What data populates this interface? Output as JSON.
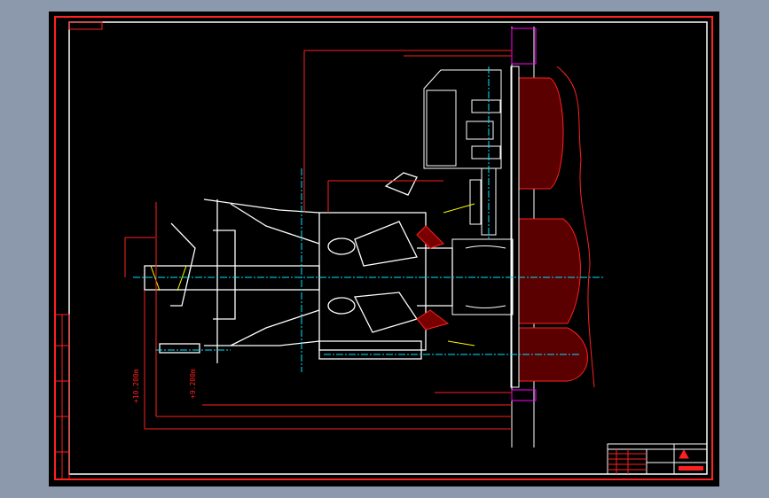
{
  "drawing": {
    "elevations": [
      "+10.200m",
      "+9.200m"
    ]
  },
  "colors": {
    "background": "#8c98ab",
    "canvas": "#000000",
    "outline": "#ffffff",
    "dimension": "#ff2020",
    "centerline": "#00e5ff",
    "highlight": "#ffff00",
    "wall": "#ff00ff"
  }
}
